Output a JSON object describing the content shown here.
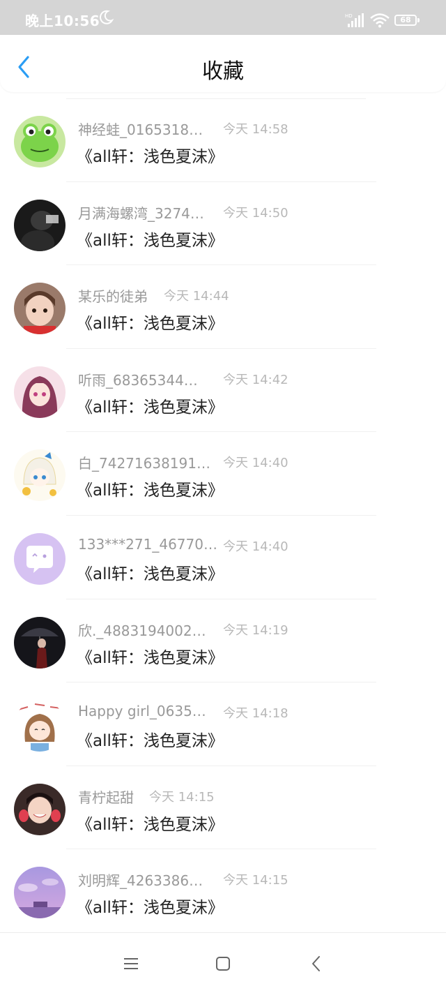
{
  "status_bar": {
    "time": "晚上10:56",
    "battery": "68",
    "icons": [
      "moon-icon",
      "signal-icon",
      "wifi-icon",
      "battery-icon"
    ]
  },
  "header": {
    "title": "收藏",
    "back_icon": "chevron-left-icon",
    "accent_color": "#2a9df4"
  },
  "items": [
    {
      "name": "神经蛙_0165318…",
      "time": "今天 14:58",
      "title": "《all轩：浅色夏沫》"
    },
    {
      "name": "月满海螺湾_3274…",
      "time": "今天 14:50",
      "title": "《all轩：浅色夏沫》"
    },
    {
      "name": "某乐的徒弟",
      "time": "今天 14:44",
      "title": "《all轩：浅色夏沫》"
    },
    {
      "name": "听雨_68365344…",
      "time": "今天 14:42",
      "title": "《all轩：浅色夏沫》"
    },
    {
      "name": "白_74271638191…",
      "time": "今天 14:40",
      "title": "《all轩：浅色夏沫》"
    },
    {
      "name": "133***271_46770…",
      "time": "今天 14:40",
      "title": "《all轩：浅色夏沫》"
    },
    {
      "name": "欣._4883194002…",
      "time": "今天 14:19",
      "title": "《all轩：浅色夏沫》"
    },
    {
      "name": "Happy girl_0635…",
      "time": "今天 14:18",
      "title": "《all轩：浅色夏沫》"
    },
    {
      "name": "青柠起甜",
      "time": "今天 14:15",
      "title": "《all轩：浅色夏沫》"
    },
    {
      "name": "刘明辉_4263386…",
      "time": "今天 14:15",
      "title": "《all轩：浅色夏沫》"
    }
  ],
  "nav_bar": {
    "icons": [
      "menu-icon",
      "home-square-icon",
      "back-triangle-icon"
    ]
  }
}
